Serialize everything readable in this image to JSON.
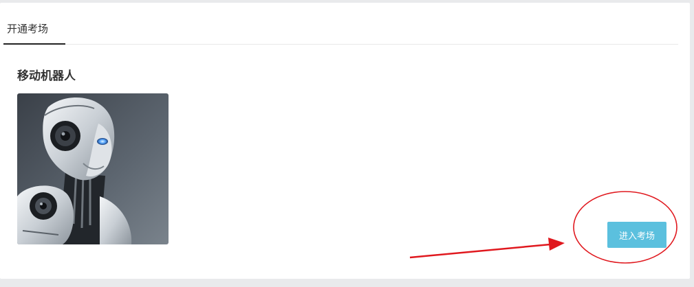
{
  "tabs": [
    {
      "label": "开通考场",
      "active": true
    }
  ],
  "card": {
    "title": "移动机器人",
    "image": "robot-head-illustration"
  },
  "actions": {
    "enter_label": "进入考场"
  },
  "colors": {
    "page_background": "#e9eaec",
    "panel_background": "#ffffff",
    "tab_active_underline": "#222222",
    "button_background": "#5bc0de",
    "button_text": "#ffffff",
    "annotation": "#e0181e"
  },
  "annotations": {
    "highlight": "circle-around-enter-button",
    "pointer": "arrow-to-enter-button"
  }
}
